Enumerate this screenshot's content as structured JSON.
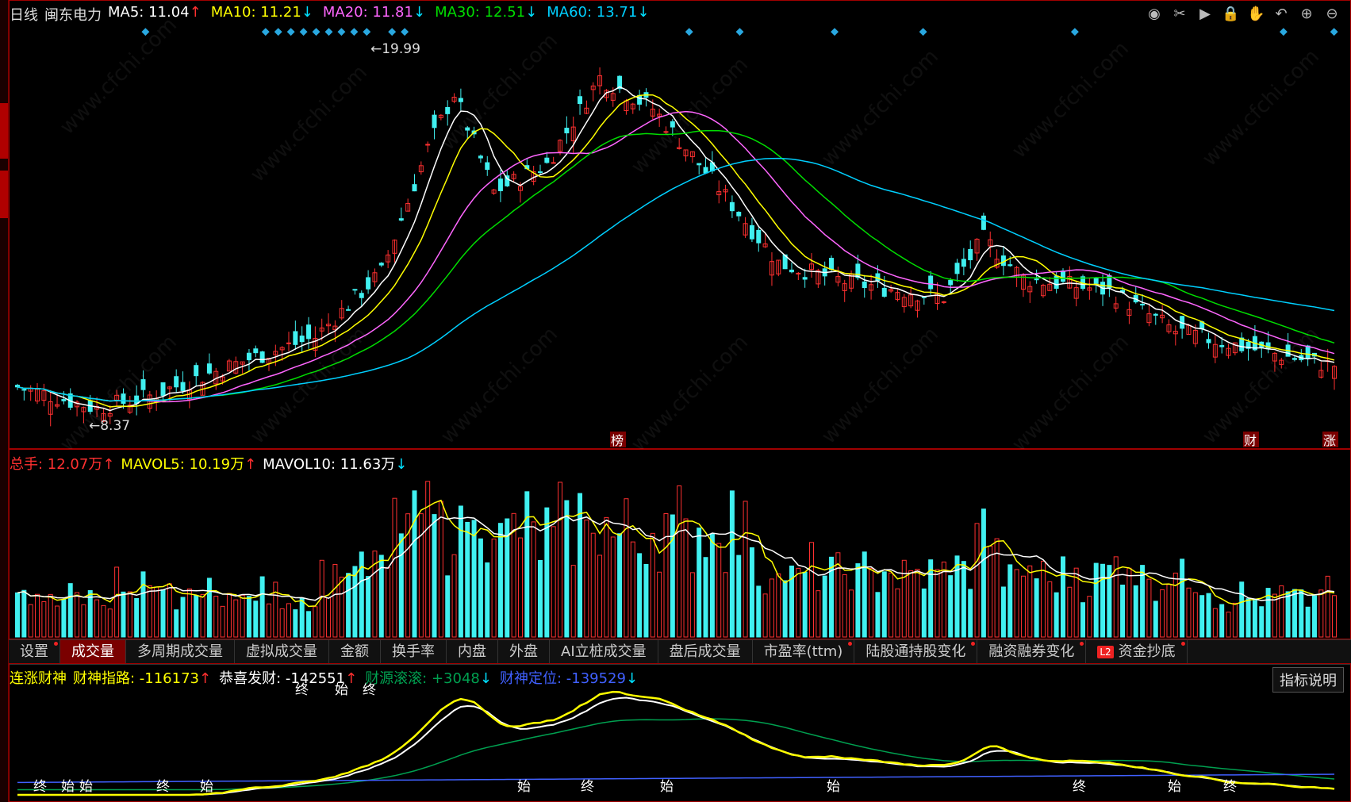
{
  "kline": {
    "period": "日线",
    "stock": "闽东电力",
    "ma": [
      {
        "label": "MA5: 11.04",
        "arrow": "↑",
        "color": "#ffffff",
        "arrow_color": "#ff3030"
      },
      {
        "label": "MA10: 11.21",
        "arrow": "↓",
        "color": "#ffff00",
        "arrow_color": "#00e0ff"
      },
      {
        "label": "MA20: 11.81",
        "arrow": "↓",
        "color": "#ff66ff",
        "arrow_color": "#00e0ff"
      },
      {
        "label": "MA30: 12.51",
        "arrow": "↓",
        "color": "#00dd00",
        "arrow_color": "#00e0ff"
      },
      {
        "label": "MA60: 13.71",
        "arrow": "↓",
        "color": "#00d0ff",
        "arrow_color": "#00e0ff"
      }
    ],
    "high_label": "19.99",
    "low_label": "8.37",
    "event_markers": [
      "榜",
      "财",
      "涨"
    ],
    "watermark": "www.cfchi.com"
  },
  "toolbar_icons": [
    "eye-icon",
    "scissors-icon",
    "play-icon",
    "lock-icon",
    "hand-icon",
    "undo-icon",
    "zoom-in-icon",
    "zoom-out-icon"
  ],
  "volume": {
    "total_label": "总手: 12.07万",
    "total_arrow": "↑",
    "mavol5_label": "MAVOL5: 10.19万",
    "mavol5_arrow": "↑",
    "mavol10_label": "MAVOL10: 11.63万",
    "mavol10_arrow": "↓"
  },
  "tabs": [
    {
      "label": "设置",
      "dot": true,
      "active": false
    },
    {
      "label": "成交量",
      "dot": false,
      "active": true
    },
    {
      "label": "多周期成交量",
      "dot": false,
      "active": false
    },
    {
      "label": "虚拟成交量",
      "dot": false,
      "active": false
    },
    {
      "label": "金额",
      "dot": false,
      "active": false
    },
    {
      "label": "换手率",
      "dot": false,
      "active": false
    },
    {
      "label": "内盘",
      "dot": false,
      "active": false
    },
    {
      "label": "外盘",
      "dot": false,
      "active": false
    },
    {
      "label": "AI立桩成交量",
      "dot": false,
      "active": false
    },
    {
      "label": "盘后成交量",
      "dot": false,
      "active": false
    },
    {
      "label": "市盈率(ttm)",
      "dot": true,
      "active": false
    },
    {
      "label": "陆股通持股变化",
      "dot": true,
      "active": false
    },
    {
      "label": "融资融券变化",
      "dot": true,
      "active": false
    },
    {
      "label": "资金抄底",
      "dot": true,
      "active": false,
      "badge": "L2"
    }
  ],
  "indicator": {
    "name": "连涨财神",
    "lines": [
      {
        "label": "财神指路: -116173",
        "arrow": "↑",
        "color": "#ffff00",
        "arrow_color": "#ff3030"
      },
      {
        "label": "恭喜发财: -142551",
        "arrow": "↑",
        "color": "#ffffff",
        "arrow_color": "#ff3030"
      },
      {
        "label": "财源滚滚: +3048",
        "arrow": "↓",
        "color": "#00a050",
        "arrow_color": "#00e0ff"
      },
      {
        "label": "财神定位: -139529",
        "arrow": "↓",
        "color": "#4060ff",
        "arrow_color": "#00e0ff"
      }
    ],
    "explain_button": "指标说明",
    "marker_start": "始",
    "marker_end": "终"
  },
  "colors": {
    "up": "#ff3030",
    "down": "#40f0f0",
    "border": "#a00000"
  }
}
